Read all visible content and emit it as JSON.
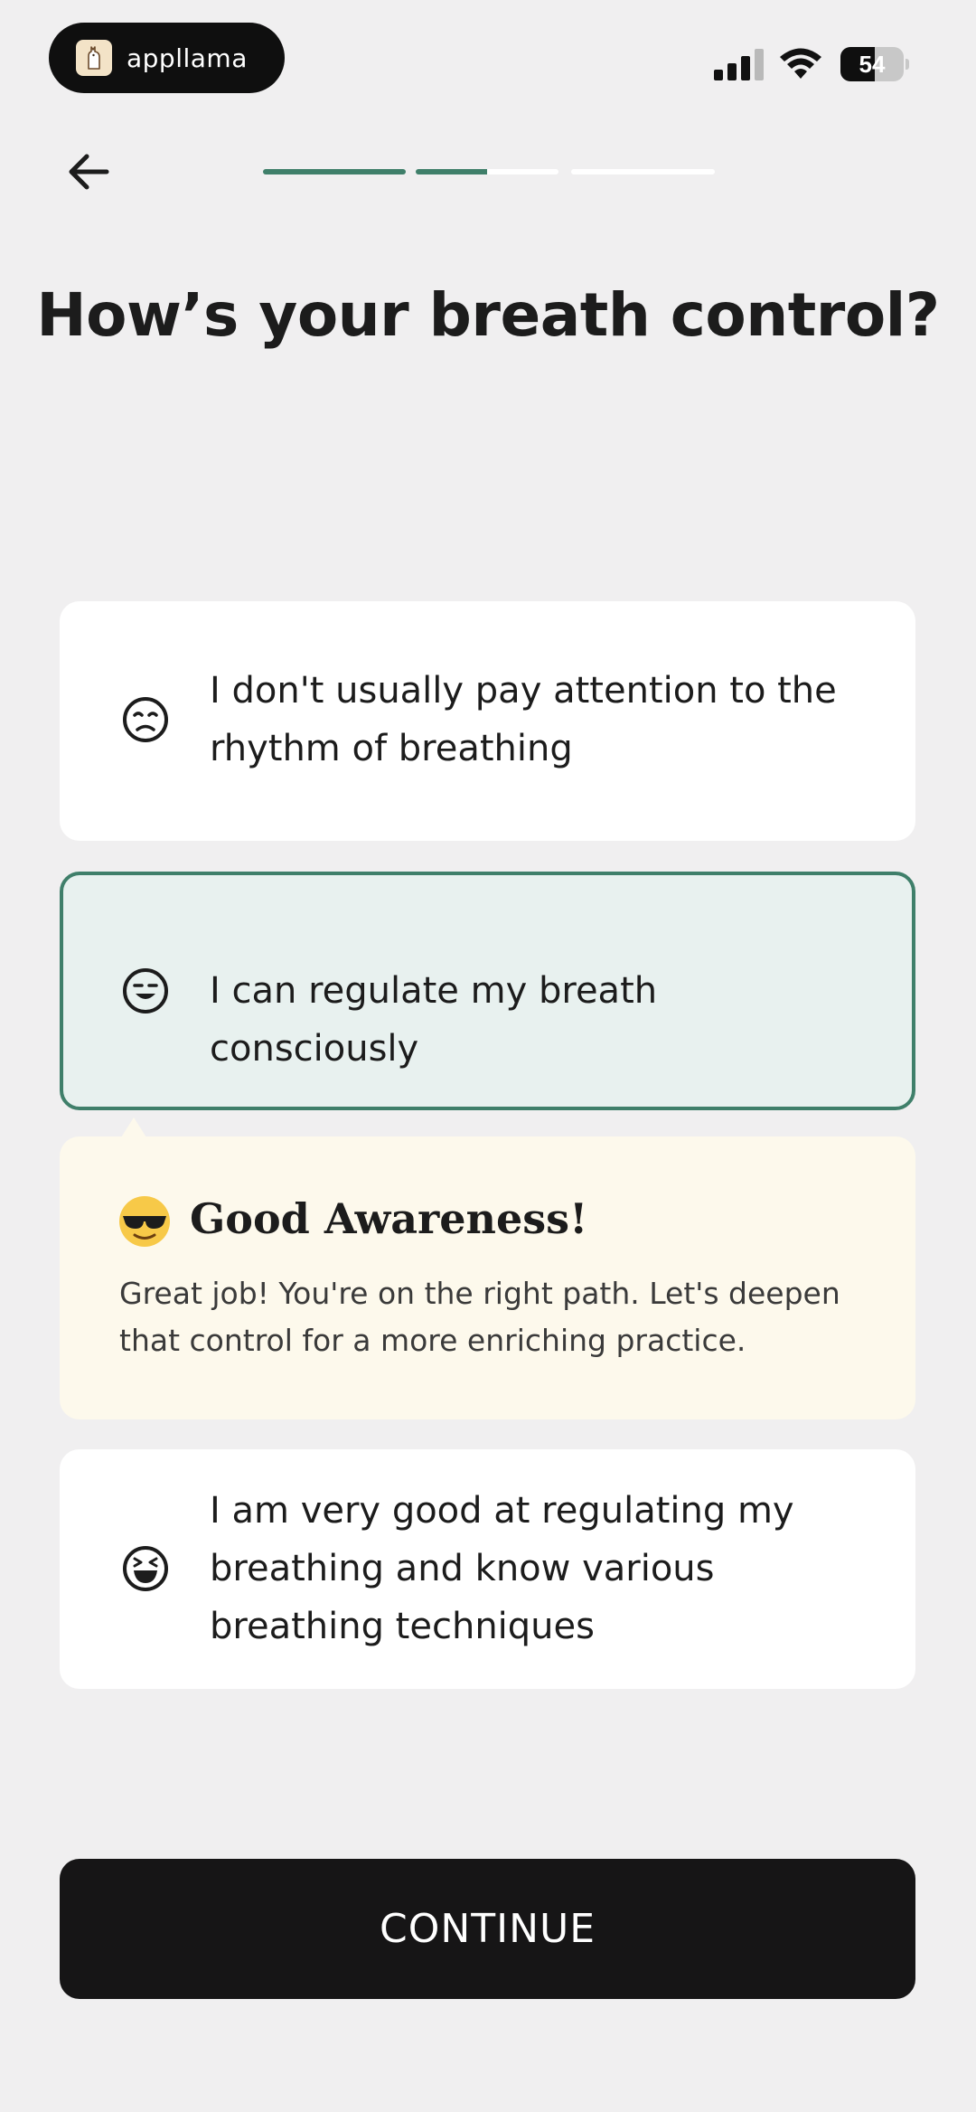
{
  "status_bar": {
    "brand": "appllama",
    "battery": "54",
    "battery_level": 0.54
  },
  "nav": {
    "back_icon": "arrow-left-icon",
    "progress": [
      1.0,
      0.5,
      0.0,
      0.0
    ],
    "progress_color": "#3f7f6a"
  },
  "question": {
    "title": "How’s your breath control?"
  },
  "options": [
    {
      "icon": "unamused-face-icon",
      "label": "I don't usually pay attention to the rhythm of breathing",
      "selected": false
    },
    {
      "icon": "smiling-face-icon",
      "label": "I can regulate my breath consciously",
      "selected": true
    },
    {
      "icon": "grinning-squinting-face-icon",
      "label": "I am very good at regulating my breathing and know various breathing techniques",
      "selected": false
    }
  ],
  "feedback": {
    "icon": "sunglasses-face-icon",
    "title": "Good Awareness!",
    "text": "Great job! You're on the right path. Let's deepen that control for a more enriching practice."
  },
  "continue_label": "CONTINUE",
  "colors": {
    "accent": "#3f7f6a",
    "selected_bg": "#e8f1ef",
    "feedback_bg": "#fdf9ec",
    "button_bg": "#161516"
  }
}
